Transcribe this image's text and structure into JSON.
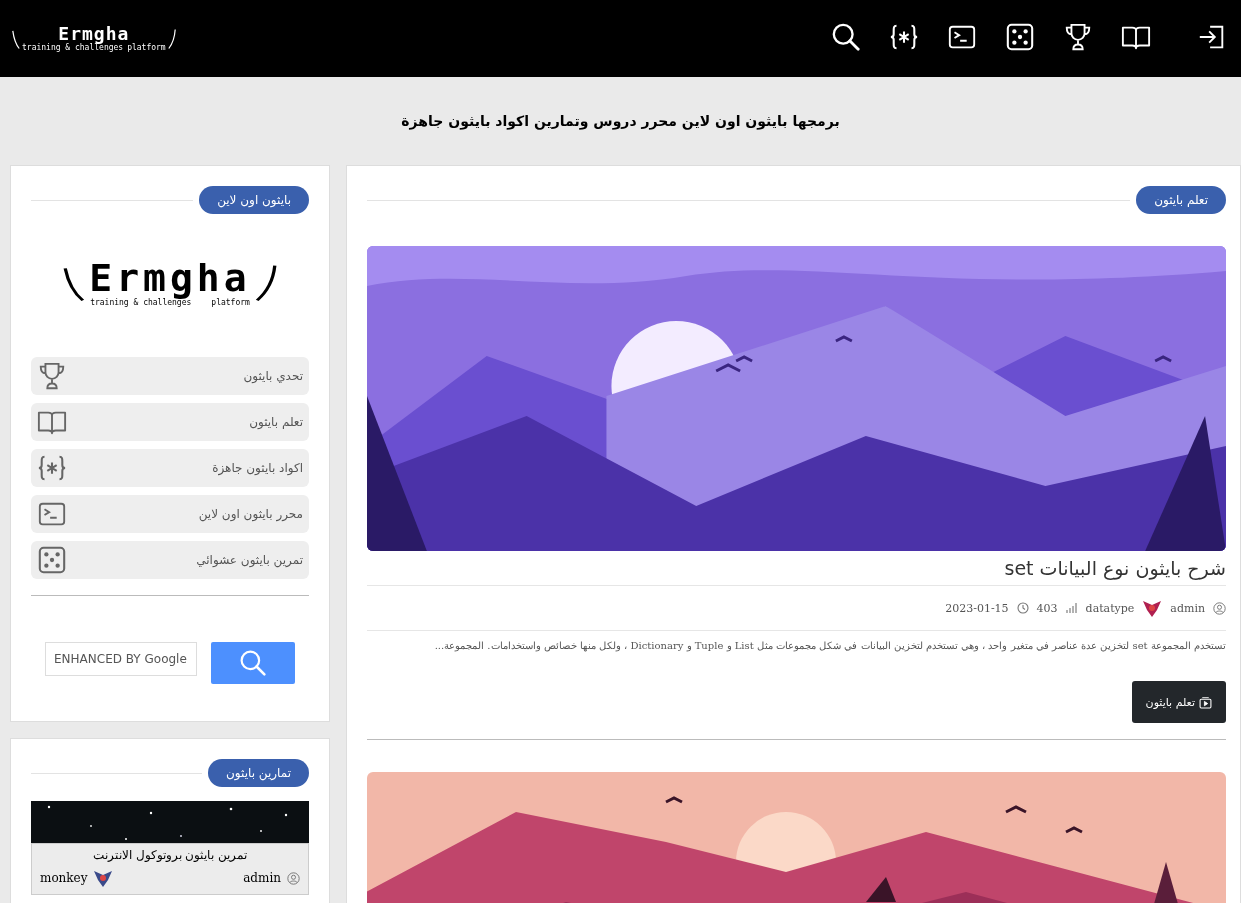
{
  "header": {
    "logo": {
      "name": "Ermgha",
      "tagline": "training & challenges",
      "platform": "platform"
    },
    "nav": [
      {
        "kind": "search"
      },
      {
        "kind": "braces"
      },
      {
        "kind": "terminal"
      },
      {
        "kind": "dice"
      },
      {
        "kind": "trophy"
      },
      {
        "kind": "book"
      },
      {
        "kind": "login"
      }
    ]
  },
  "banner": "برمجها بايثون اون لاين محرر دروس وتمارين اكواد بايثون جاهزة",
  "sidebar": [
    {
      "kind": "menu",
      "title": "بايثون اون لاين",
      "logo": {
        "name": "Ermgha",
        "tagline": "training & challenges",
        "platform": "platform"
      },
      "menu": [
        {
          "label": "تحدي بايثون",
          "kind": "trophy"
        },
        {
          "label": "تعلم بايثون",
          "kind": "book"
        },
        {
          "label": "اكواد بايثون جاهزة",
          "kind": "braces"
        },
        {
          "label": "محرر بايثون اون لاين",
          "kind": "terminal"
        },
        {
          "label": "تمرين بايثون عشوائي",
          "kind": "dice"
        }
      ],
      "search": {
        "placeholder": "ENHANCED BY Google"
      }
    },
    {
      "kind": "posts",
      "title": "تمارين بايثون",
      "posts": [
        {
          "title": "تمرين بايثون بروتوكول الانترنت",
          "author": "admin",
          "category": "monkey"
        }
      ]
    }
  ],
  "main": {
    "section": "تعلم بايثون",
    "posts": [
      {
        "kind": "article",
        "title": "شرح بايثون نوع البيانات set",
        "author": "admin",
        "category": "datatype",
        "views": "403",
        "date": "2023-01-15",
        "excerpt": "تستخدم المجموعة set لتخزين عدة عناصر في متغير واحد ، وهي تستخدم لتخزين البيانات في شكل مجموعات مثل List و Tuple و Dictionary ، ولكل منها خصائص واستخدامات. المجموعة...",
        "button": "تعلم بايثون"
      },
      {
        "kind": "picture"
      }
    ]
  }
}
